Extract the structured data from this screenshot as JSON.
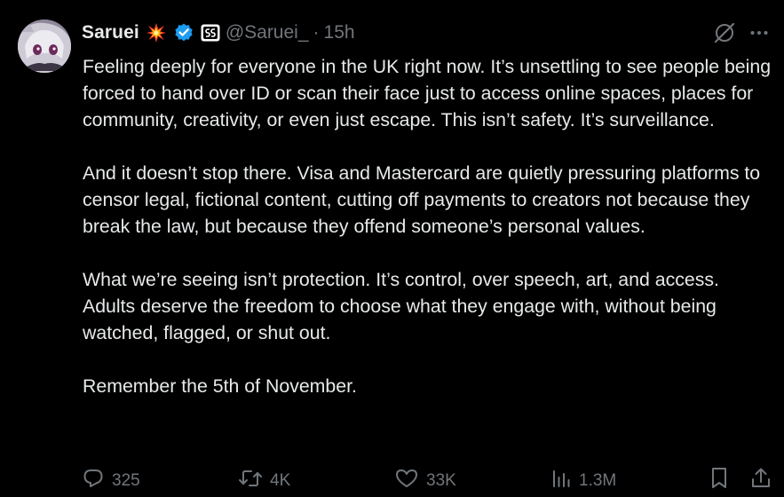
{
  "tweet": {
    "author": {
      "display_name": "Saruei",
      "handle": "@Saruei_",
      "time": "15h",
      "separator": "·",
      "emoji_icon": "collision-emoji-icon",
      "verified_icon": "verified-badge-icon",
      "affiliate_icon": "affiliate-badge-icon"
    },
    "paragraphs": [
      "Feeling deeply for everyone in the UK right now. It’s unsettling to see people being forced to hand over ID or scan their face just to access online spaces, places for community, creativity, or even just escape. This isn’t safety. It’s surveillance.",
      "And it doesn’t stop there. Visa and Mastercard are quietly pressuring platforms to censor legal, fictional content, cutting off payments to creators not because they break the law, but because they offend someone’s personal values.",
      "What we’re seeing isn’t protection. It’s control, over speech, art, and access. Adults deserve the freedom to choose what they engage with, without being watched, flagged, or shut out.",
      "Remember the 5th of November."
    ],
    "actions": {
      "replies": "325",
      "reposts": "4K",
      "likes": "33K",
      "views": "1.3M"
    },
    "colors": {
      "background": "#000000",
      "text": "#e7e9ea",
      "muted": "#71767b",
      "verified": "#1d9bf0"
    }
  }
}
